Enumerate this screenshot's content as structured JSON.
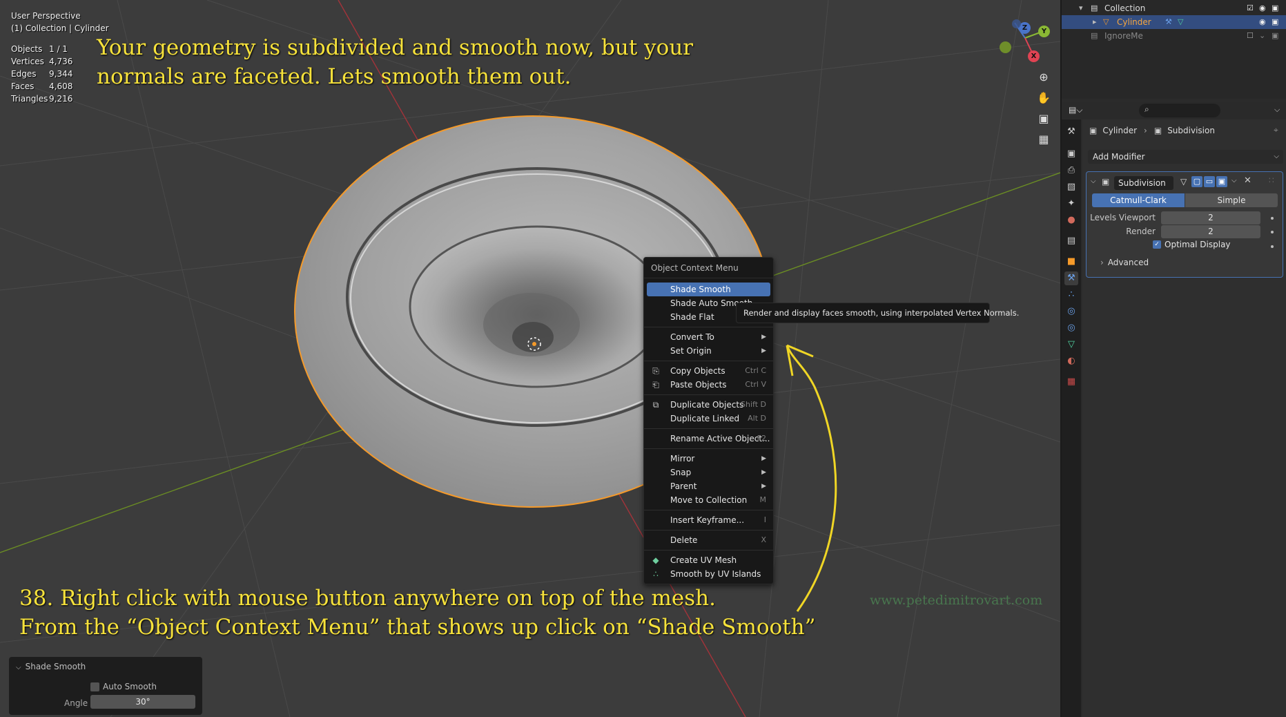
{
  "viewport": {
    "perspective_label": "User Perspective",
    "collection_label": "(1) Collection | Cylinder",
    "stats": [
      {
        "key": "Objects",
        "value": "1 / 1"
      },
      {
        "key": "Vertices",
        "value": "4,736"
      },
      {
        "key": "Edges",
        "value": "9,344"
      },
      {
        "key": "Faces",
        "value": "4,608"
      },
      {
        "key": "Triangles",
        "value": "9,216"
      }
    ],
    "gizmo": {
      "z": "Z",
      "y": "Y",
      "x": "X"
    },
    "nav_icons": [
      "zoom-icon",
      "hand-pan-icon",
      "camera-icon",
      "grid-ortho-icon"
    ]
  },
  "tutorial": {
    "top_line1": "Your geometry is subdivided and smooth now, but your",
    "top_line2": "normals are faceted. Lets smooth them out.",
    "bottom_line1": "38. Right click with mouse button anywhere on top of the mesh.",
    "bottom_line2": "From the “Object Context Menu” that shows up click on “Shade Smooth”",
    "watermark": "www.petedimitrovart.com"
  },
  "context_menu": {
    "title": "Object Context Menu",
    "items": [
      {
        "label": "Shade Smooth",
        "shortcut": "",
        "active": true
      },
      {
        "label": "Shade Auto Smooth",
        "shortcut": ""
      },
      {
        "label": "Shade Flat",
        "shortcut": ""
      },
      {
        "label": "Convert To",
        "shortcut": "▶"
      },
      {
        "label": "Set Origin",
        "shortcut": "▶"
      },
      {
        "label": "Copy Objects",
        "shortcut": "Ctrl C"
      },
      {
        "label": "Paste Objects",
        "shortcut": "Ctrl V"
      },
      {
        "label": "Duplicate Objects",
        "shortcut": "Shift D"
      },
      {
        "label": "Duplicate Linked",
        "shortcut": "Alt D"
      },
      {
        "label": "Rename Active Object...",
        "shortcut": "F2"
      },
      {
        "label": "Mirror",
        "shortcut": "▶"
      },
      {
        "label": "Snap",
        "shortcut": "▶"
      },
      {
        "label": "Parent",
        "shortcut": "▶"
      },
      {
        "label": "Move to Collection",
        "shortcut": "M"
      },
      {
        "label": "Insert Keyframe...",
        "shortcut": "I"
      },
      {
        "label": "Delete",
        "shortcut": "X"
      },
      {
        "label": "Create UV Mesh",
        "shortcut": ""
      },
      {
        "label": "Smooth by UV Islands",
        "shortcut": ""
      }
    ],
    "tooltip": "Render and display faces smooth, using interpolated Vertex Normals."
  },
  "redo_panel": {
    "title": "Shade Smooth",
    "auto_smooth_label": "Auto Smooth",
    "angle_label": "Angle",
    "angle_value": "30°"
  },
  "outliner": {
    "rows": [
      {
        "name": "Collection"
      },
      {
        "name": "Cylinder"
      },
      {
        "name": "IgnoreMe"
      }
    ]
  },
  "properties": {
    "breadcrumb_object": "Cylinder",
    "breadcrumb_modifier": "Subdivision",
    "add_modifier": "Add Modifier",
    "modifier_name": "Subdivision",
    "type_left": "Catmull-Clark",
    "type_right": "Simple",
    "levels_viewport_label": "Levels Viewport",
    "levels_viewport_value": "2",
    "render_label": "Render",
    "render_value": "2",
    "optimal_display_label": "Optimal Display",
    "advanced_label": "Advanced"
  },
  "colors": {
    "accent": "#4772b3",
    "tutorial_text": "#f7e23b",
    "selection_outline": "#f59a2a"
  }
}
